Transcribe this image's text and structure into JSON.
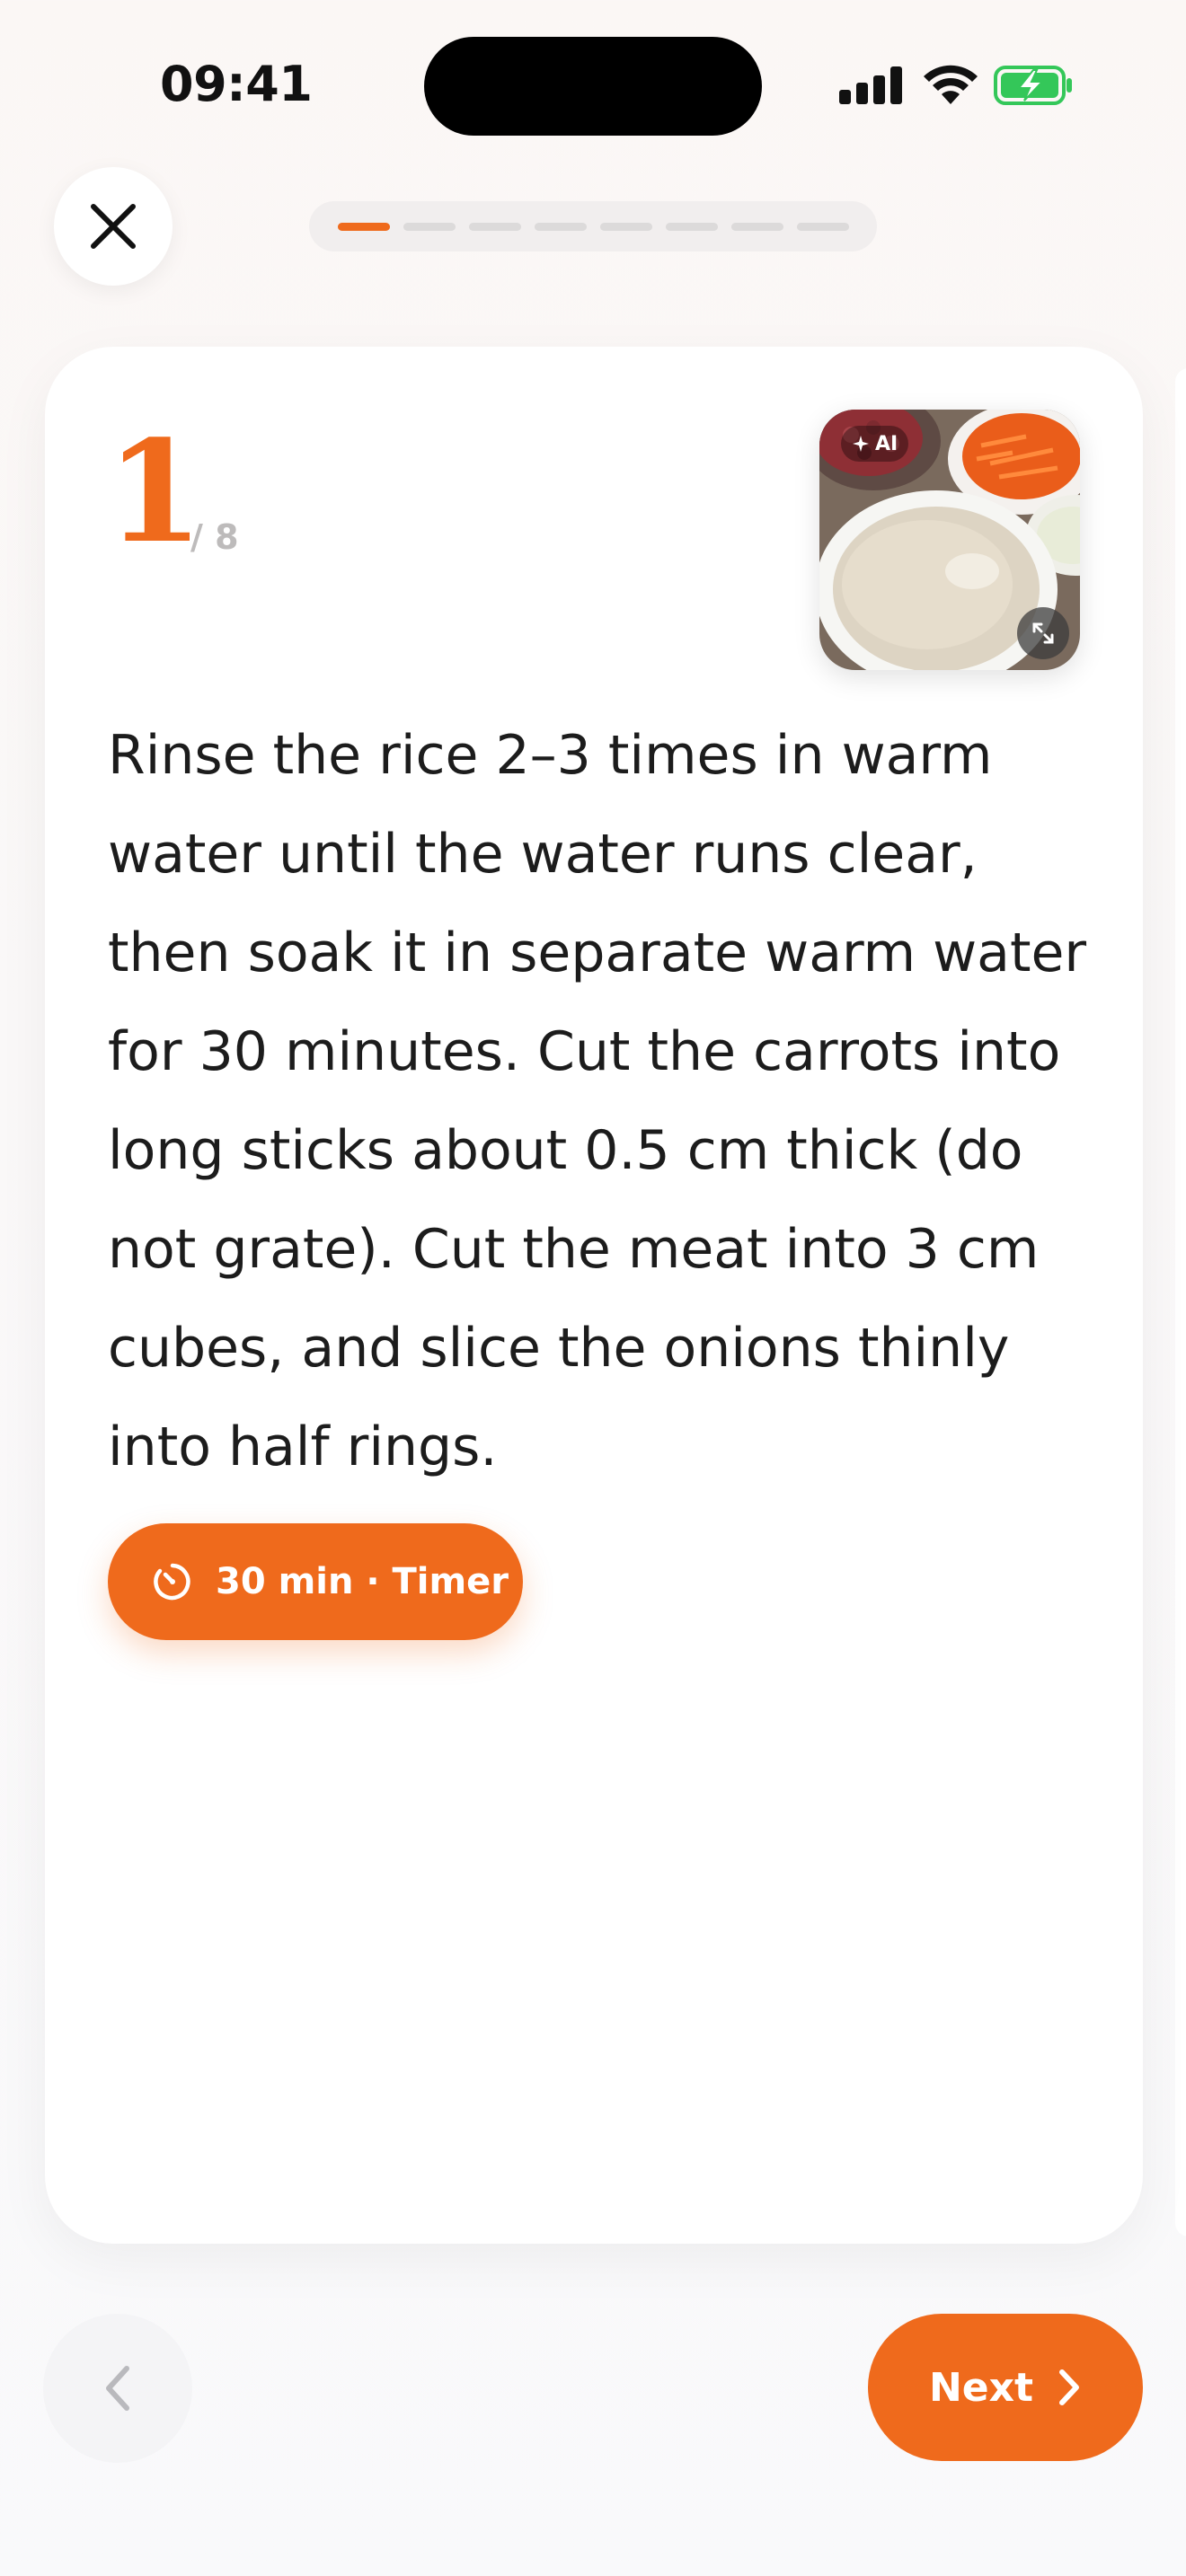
{
  "status_bar": {
    "time": "09:41",
    "icons": [
      "signal-icon",
      "wifi-icon",
      "battery-charging-icon"
    ]
  },
  "header": {
    "close_icon": "close-icon",
    "progress": {
      "current_step": 1,
      "total_steps": 8
    }
  },
  "step": {
    "number": "1",
    "total": "/ 8",
    "image": {
      "badge_label": "AI",
      "badge_icon": "sparkle-icon",
      "expand_icon": "expand-icon"
    },
    "instruction": "Rinse the rice 2–3 times in warm water until the water runs clear, then soak it in separate warm water for 30 minutes. Cut the carrots into long sticks about 0.5 cm thick (do not grate). Cut the meat into 3 cm cubes, and slice the onions thinly into half rings.",
    "timer": {
      "label": "30 min · Timer",
      "icon": "timer-icon"
    }
  },
  "navigation": {
    "prev_icon": "chevron-left-icon",
    "next_label": "Next",
    "next_icon": "chevron-right-icon"
  },
  "colors": {
    "accent": "#ef6a1c",
    "text": "#1c1c1c",
    "muted": "#bdbbbb",
    "battery": "#34c759"
  }
}
